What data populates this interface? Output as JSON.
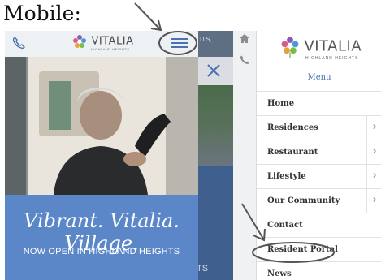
{
  "caption": "Mobile:",
  "phone1": {
    "brand_name": "VITALIA",
    "brand_sub": "HIGHLAND HEIGHTS",
    "slogan_line1": "Vibrant. Vitalia.",
    "slogan_line2": "Village.",
    "announcement": "NOW OPEN IN HIGHLAND HEIGHTS",
    "phone_icon": "phone-icon",
    "menu_icon": "hamburger-menu-icon"
  },
  "phone2": {
    "close_icon": "close-icon",
    "partial_text_top": "ITS,",
    "partial_text_bottom": "TS"
  },
  "phone3": {
    "brand_name": "VITALIA",
    "brand_sub": "HIGHLAND HEIGHTS",
    "menu_title": "Menu",
    "rail_icons": [
      "home-icon",
      "phone-icon"
    ],
    "items": [
      {
        "label": "Home",
        "has_submenu": false
      },
      {
        "label": "Residences",
        "has_submenu": true
      },
      {
        "label": "Restaurant",
        "has_submenu": true
      },
      {
        "label": "Lifestyle",
        "has_submenu": true
      },
      {
        "label": "Our Community",
        "has_submenu": true
      },
      {
        "label": "Contact",
        "has_submenu": false
      },
      {
        "label": "Resident Portal",
        "has_submenu": false
      },
      {
        "label": "News",
        "has_submenu": false
      }
    ]
  },
  "colors": {
    "brand_blue": "#5b87c8",
    "menu_title_blue": "#4a72b0",
    "annotation_gray": "#555555"
  }
}
